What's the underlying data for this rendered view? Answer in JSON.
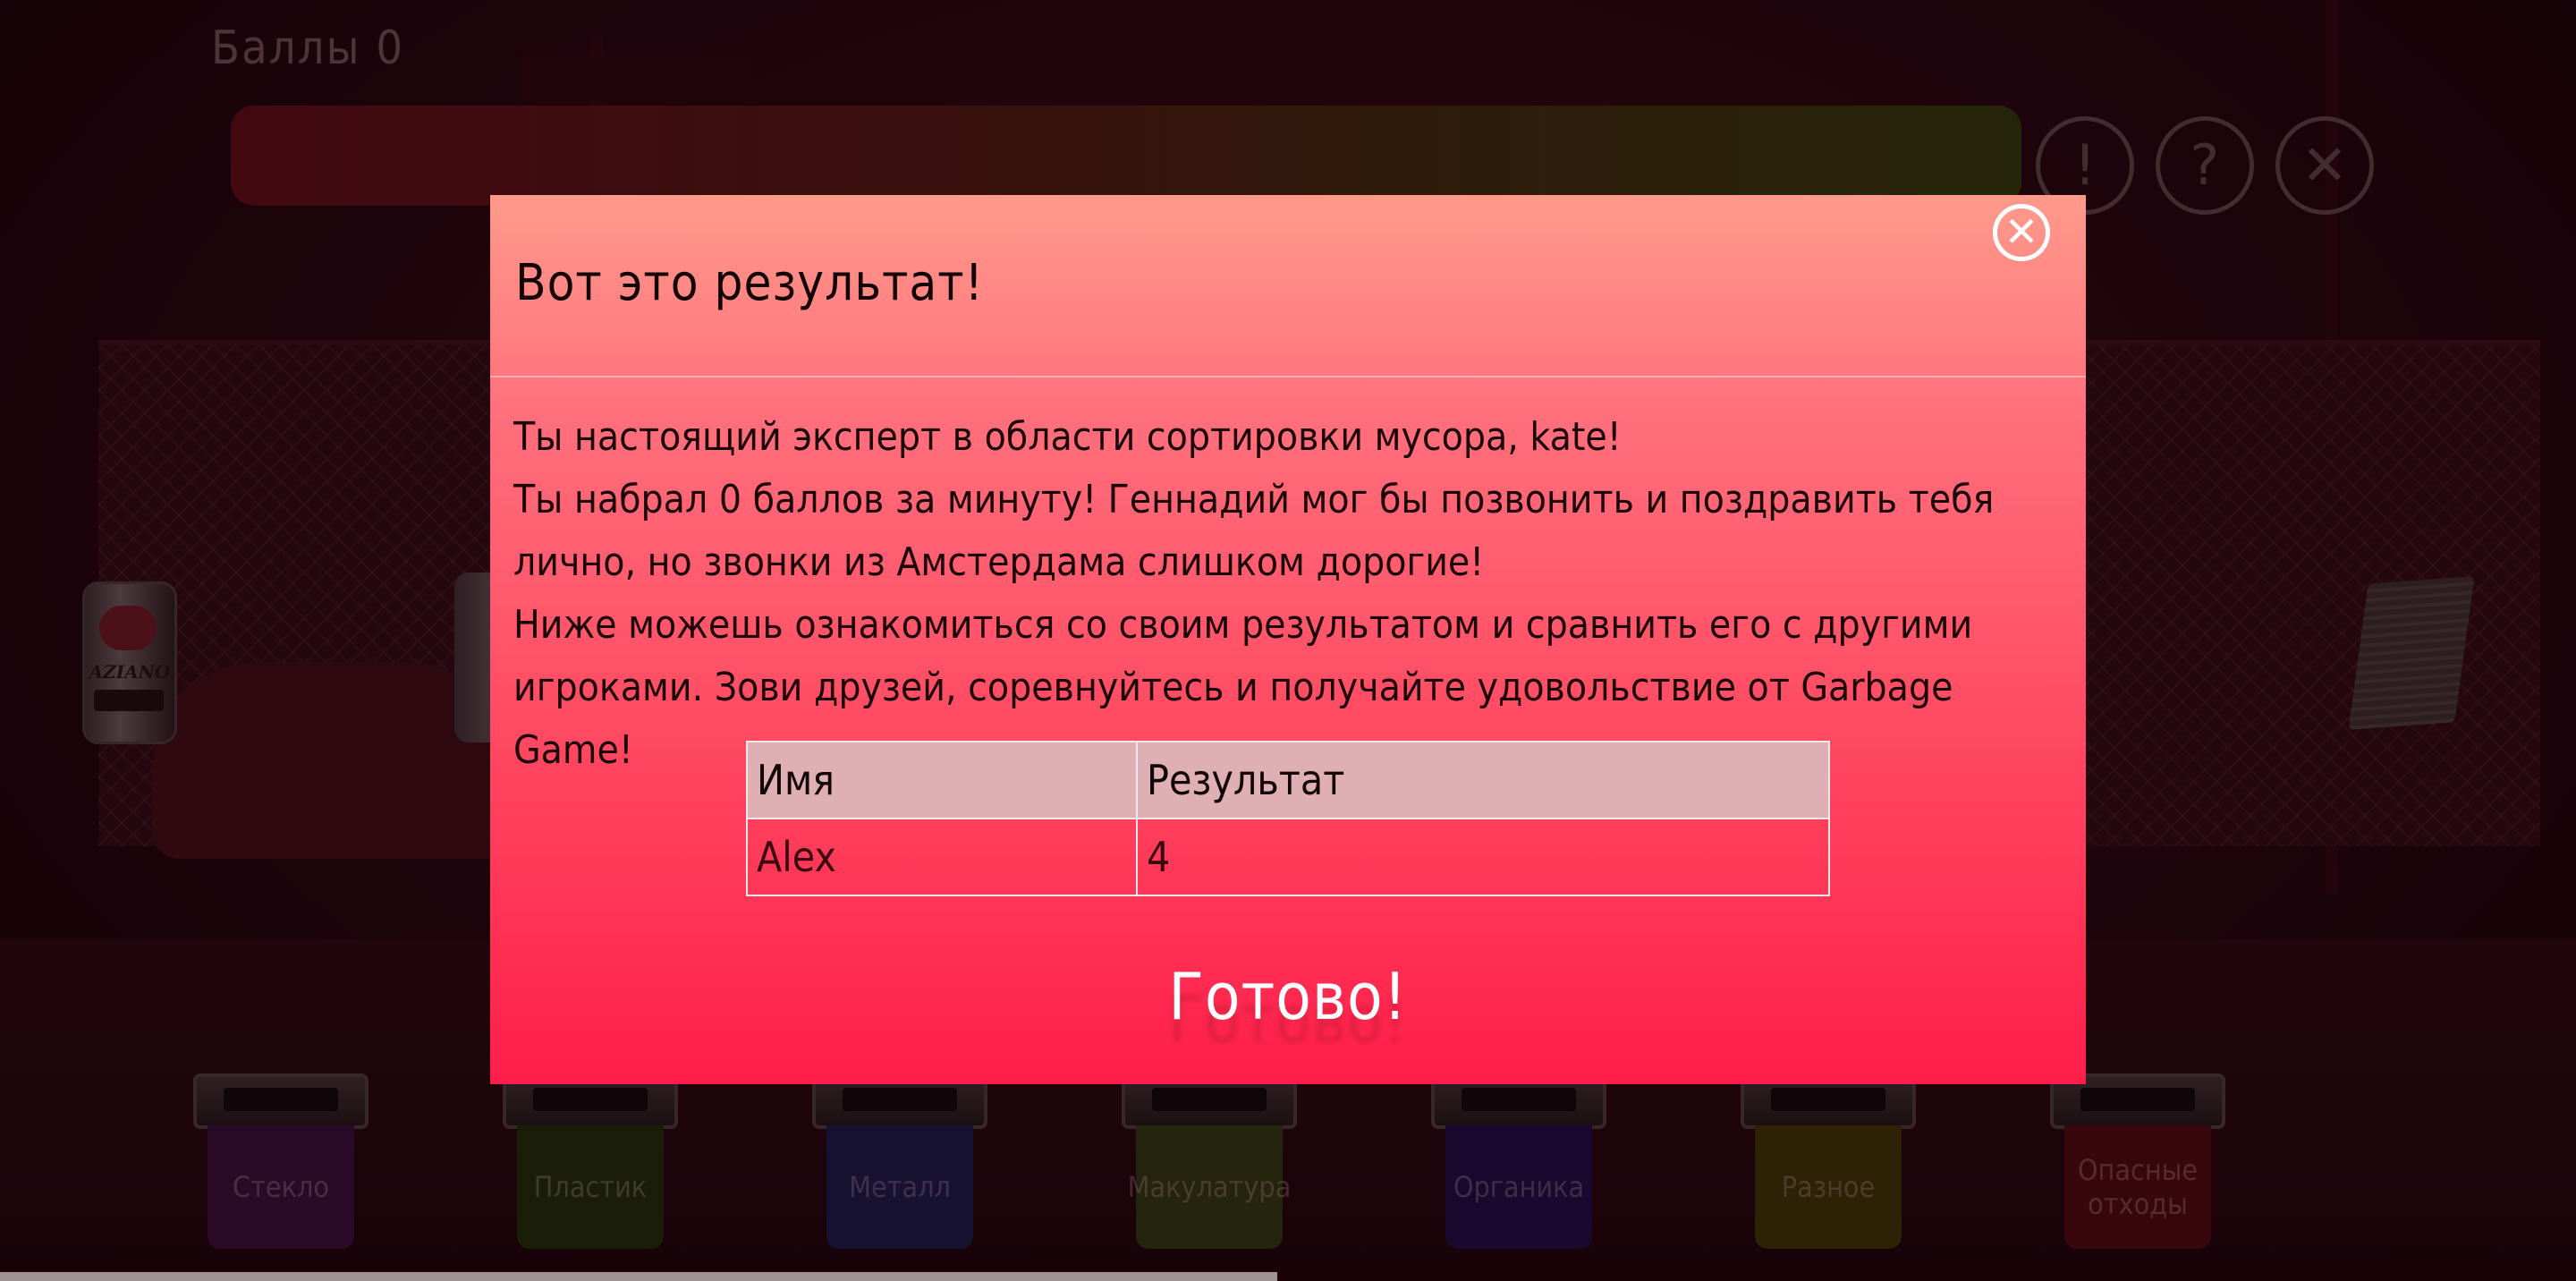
{
  "hud": {
    "score_label": "Баллы 0",
    "buttons": [
      {
        "name": "info",
        "glyph": "!"
      },
      {
        "name": "help",
        "glyph": "?"
      },
      {
        "name": "close",
        "glyph": "✕"
      }
    ]
  },
  "items": {
    "can_brand": "AZIANO"
  },
  "bins": [
    {
      "label": "Стекло",
      "color": "#35103a"
    },
    {
      "label": "Пластик",
      "color": "#1e2e0c"
    },
    {
      "label": "Металл",
      "color": "#1a1b4a"
    },
    {
      "label": "Макулатура",
      "color": "#2f3810"
    },
    {
      "label": "Органика",
      "color": "#1e0f46"
    },
    {
      "label": "Разное",
      "color": "#3b3307"
    },
    {
      "label": "Опасные отходы",
      "color": "#4c0c12"
    }
  ],
  "modal": {
    "title": "Вот это результат!",
    "close_glyph": "✕",
    "paragraphs": [
      "Ты настоящий эксперт в области сортировки мусора, kate!",
      "Ты набрал 0 баллов за минуту! Геннадий мог бы позвонить и поздравить тебя лично, но звонки из Амстердама слишком дорогие!",
      "Ниже можешь ознакомиться со своим результатом и сравнить его с другими игроками. Зови друзей, соревнуйтесь и получайте удовольствие от Garbage Game!"
    ],
    "table": {
      "headers": [
        "Имя",
        "Результат"
      ],
      "rows": [
        [
          "Alex",
          "4"
        ]
      ]
    },
    "done_label": "Готово!"
  },
  "colors": {
    "modal_top": "#ff9a8b",
    "modal_bottom": "#ff1e4a",
    "backdrop": "#240710"
  }
}
